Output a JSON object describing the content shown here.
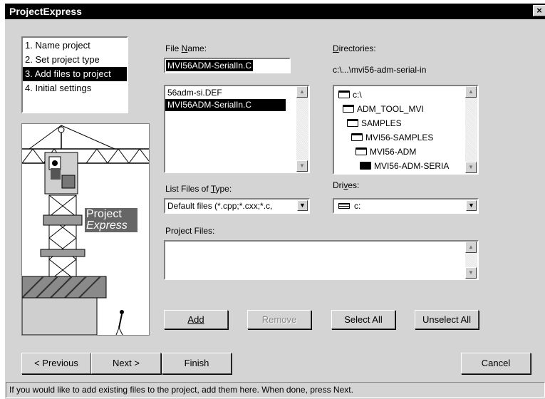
{
  "window": {
    "title": "ProjectExpress",
    "close_label": "×"
  },
  "steps": [
    {
      "label": "1. Name project",
      "selected": false
    },
    {
      "label": "2. Set project type",
      "selected": false
    },
    {
      "label": "3. Add files to project",
      "selected": true
    },
    {
      "label": "4. Initial settings",
      "selected": false
    }
  ],
  "logo": {
    "line1": "Project",
    "line2": "Express"
  },
  "file_name": {
    "label_pre": "File ",
    "label_ul": "N",
    "label_post": "ame:",
    "value": "MVI56ADM-SerialIn.C"
  },
  "files_list": [
    {
      "label": "56adm-si.DEF",
      "selected": false
    },
    {
      "label": "MVI56ADM-SerialIn.C",
      "selected": true
    }
  ],
  "file_type": {
    "label_pre": "List Files of ",
    "label_ul": "T",
    "label_post": "ype:",
    "value": "Default files (*.cpp;*.cxx;*.c,"
  },
  "directories": {
    "label_ul": "D",
    "label_post": "irectories:",
    "path": "c:\\...\\mvi56-adm-serial-in",
    "items": [
      {
        "label": "c:\\"
      },
      {
        "label": "ADM_TOOL_MVI"
      },
      {
        "label": "SAMPLES"
      },
      {
        "label": "MVI56-SAMPLES"
      },
      {
        "label": "MVI56-ADM"
      },
      {
        "label": "MVI56-ADM-SERIA"
      }
    ]
  },
  "drives": {
    "label_pre": "Dri",
    "label_ul": "v",
    "label_post": "es:",
    "value": "c:"
  },
  "project_files": {
    "label": "Project Files:"
  },
  "buttons": {
    "add": "Add",
    "remove": "Remove",
    "select_all": "Select All",
    "unselect_all": "Unselect All",
    "previous": "< Previous",
    "next": "Next >",
    "finish": "Finish",
    "cancel": "Cancel"
  },
  "status": "If you would like to add existing files to the project, add them here.  When done, press Next."
}
